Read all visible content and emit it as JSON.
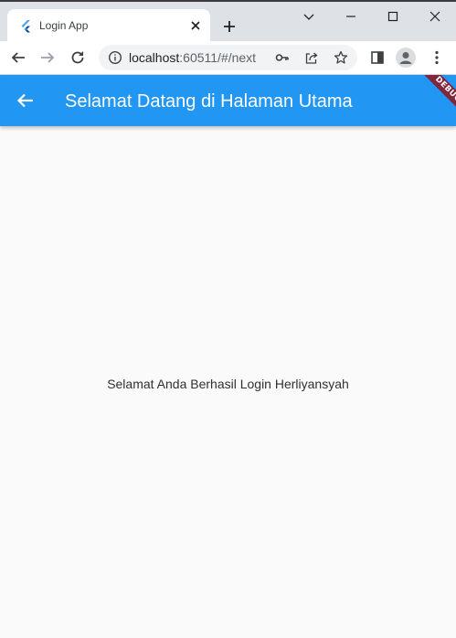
{
  "browser": {
    "tab": {
      "title": "Login App",
      "favicon": "flutter-icon"
    },
    "window_controls": [
      "chevron-down-icon",
      "minimize-icon",
      "maximize-icon",
      "close-icon"
    ],
    "address_bar": {
      "host": "localhost",
      "path": ":60511/#/next"
    },
    "colors": {
      "tabstrip": "#dee1e6",
      "omnibox": "#f1f3f4"
    }
  },
  "app": {
    "appbar": {
      "title": "Selamat Datang di Halaman Utama",
      "color": "#2196f3"
    },
    "debug_banner": "DEBUG",
    "message": "Selamat Anda Berhasil Login Herliyansyah"
  }
}
